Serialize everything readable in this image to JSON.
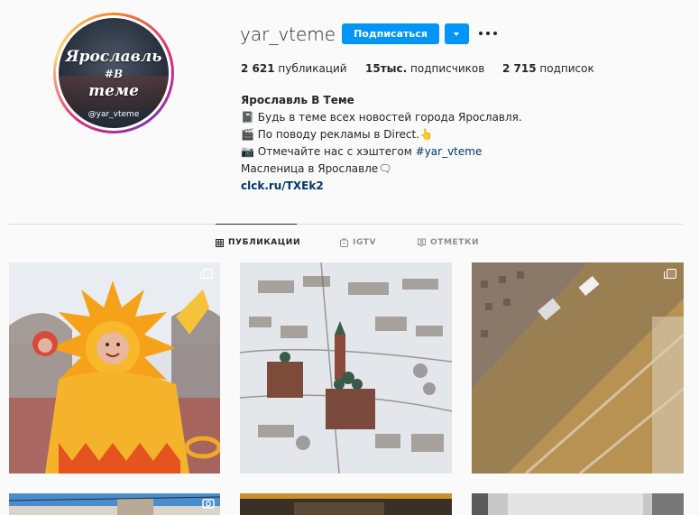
{
  "profile": {
    "username": "yar_vteme",
    "avatar": {
      "logo_line1": "Ярославль",
      "logo_line2": "#В",
      "logo_line3": "теме",
      "logo_handle": "@yar_vteme"
    },
    "follow_label": "Подписаться",
    "stats": {
      "posts_value": "2 621",
      "posts_label": "публикаций",
      "followers_value": "15тыс.",
      "followers_label": "подписчиков",
      "following_value": "2 715",
      "following_label": "подписок"
    },
    "bio": {
      "name": "Ярославль В Теме",
      "line1": "📓 Будь в теме всех новостей города Ярославля.",
      "line2": "🎬 По поводу рекламы в Direct.👆",
      "line3_prefix": "📷 Отмечайте нас с хэштегом ",
      "line3_hashtag": "#yar_vteme",
      "line4": "Масленица в Ярославле🗨",
      "link": "clck.ru/TXEk2"
    }
  },
  "tabs": [
    {
      "label": "ПУБЛИКАЦИИ",
      "icon": "grid-icon",
      "active": true
    },
    {
      "label": "IGTV",
      "icon": "igtv-icon",
      "active": false
    },
    {
      "label": "ОТМЕТКИ",
      "icon": "tagged-icon",
      "active": false
    }
  ],
  "posts": [
    {
      "subject": "maslenitsa-sun-costume",
      "multi": true
    },
    {
      "subject": "aerial-winter-town-church",
      "multi": false
    },
    {
      "subject": "slushy-street-aerial",
      "multi": true
    },
    {
      "subject": "street-blue-sky",
      "multi": false
    },
    {
      "subject": "dark-photo",
      "multi": false
    },
    {
      "subject": "window-frost",
      "multi": false
    }
  ]
}
